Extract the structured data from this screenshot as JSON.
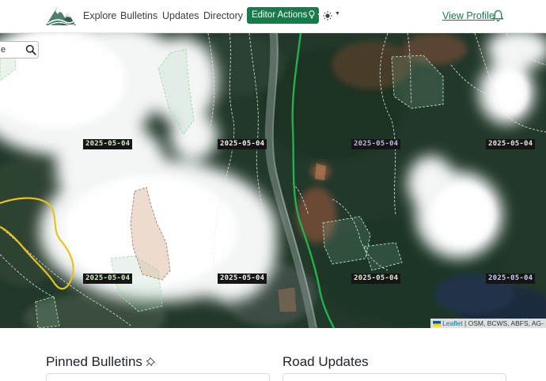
{
  "nav": {
    "logo_icon": "mountain-logo-icon",
    "links": [
      "Explore",
      "Bulletins",
      "Updates",
      "Directory"
    ],
    "editor_actions_label": "Editor Actions",
    "theme_icon": "sun-icon",
    "view_profile_label": "View Profile",
    "bell_icon": "bell-icon"
  },
  "map": {
    "search": {
      "value": "e"
    },
    "date_labels": [
      "2025-05-04",
      "2025-05-04",
      "2025-05-04",
      "2025-05-04",
      "2025-05-04",
      "2025-05-04",
      "2025-05-04",
      "2025-05-04"
    ],
    "attribution": {
      "leaflet": "Leaflet",
      "rest": " | OSM, BCWS, ABFS, AG-"
    }
  },
  "sections": {
    "pinned_bulletins": "Pinned Bulletins",
    "road_updates": "Road Updates"
  },
  "colors": {
    "brand_green": "#1a7a4c",
    "route_green": "#22b14c",
    "boundary_yellow": "#e8c222"
  }
}
